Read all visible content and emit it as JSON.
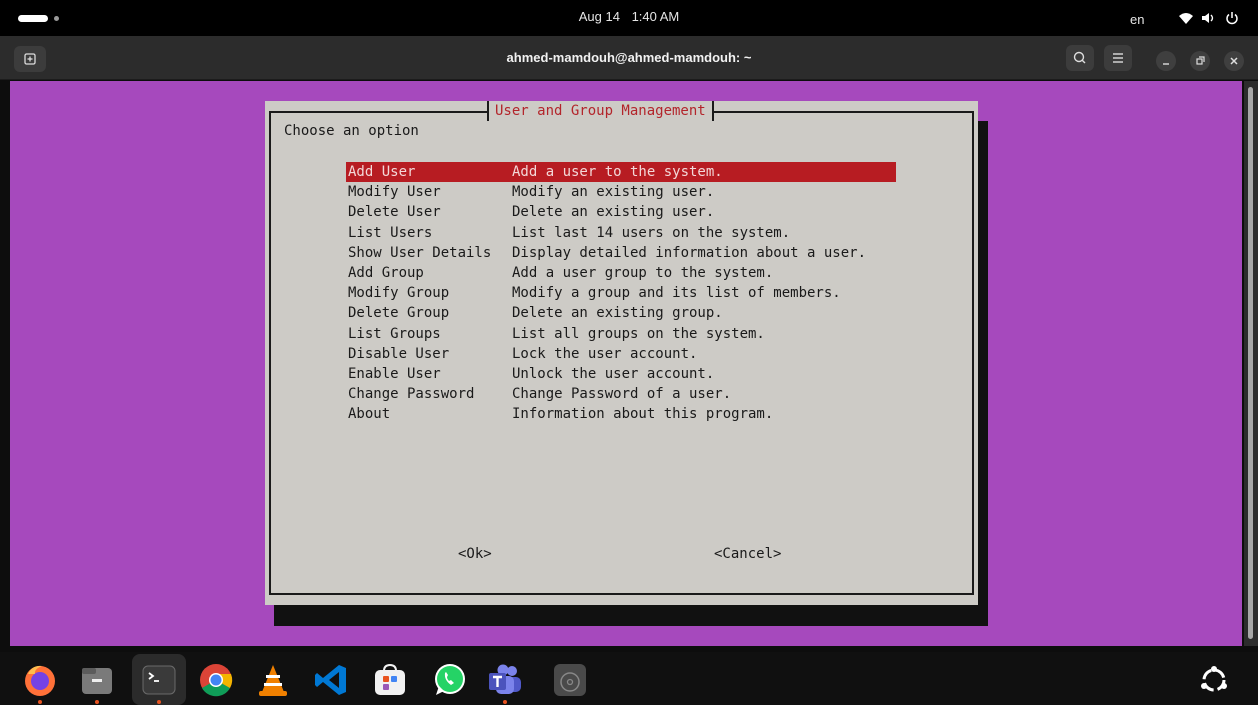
{
  "topbar": {
    "date": "Aug 14",
    "time": "1:40 AM",
    "language": "en"
  },
  "window": {
    "title": "ahmed-mamdouh@ahmed-mamdouh: ~"
  },
  "dialog": {
    "title": "User and Group Management",
    "prompt": "Choose an option",
    "menu": [
      {
        "tag": "Add User",
        "desc": "Add a user to the system."
      },
      {
        "tag": "Modify User",
        "desc": "Modify an existing user."
      },
      {
        "tag": "Delete User",
        "desc": "Delete an existing user."
      },
      {
        "tag": "List Users",
        "desc": "List last 14 users on the system."
      },
      {
        "tag": "Show User Details",
        "desc": "Display detailed information about a user."
      },
      {
        "tag": "Add Group",
        "desc": "Add a user group to the system."
      },
      {
        "tag": "Modify Group",
        "desc": "Modify a group and its list of members."
      },
      {
        "tag": "Delete Group",
        "desc": "Delete an existing group."
      },
      {
        "tag": "List Groups",
        "desc": "List all groups on the system."
      },
      {
        "tag": "Disable User",
        "desc": "Lock the user account."
      },
      {
        "tag": "Enable User",
        "desc": "Unlock the user account."
      },
      {
        "tag": "Change Password",
        "desc": "Change Password of a user."
      },
      {
        "tag": "About",
        "desc": "Information about this program."
      }
    ],
    "selected_index": 0,
    "ok_label": "<Ok>",
    "cancel_label": "<Cancel>"
  },
  "colors": {
    "terminal_background": "#a649bd",
    "dialog_background": "#cdcbc6",
    "selection": "#b71c22",
    "title_text": "#b3252b"
  },
  "dock": {
    "apps": [
      "firefox-icon",
      "files-icon",
      "terminal-icon",
      "chrome-icon",
      "vlc-icon",
      "vscode-icon",
      "app-center-icon",
      "whatsapp-icon",
      "teams-icon",
      "disc-icon"
    ]
  }
}
